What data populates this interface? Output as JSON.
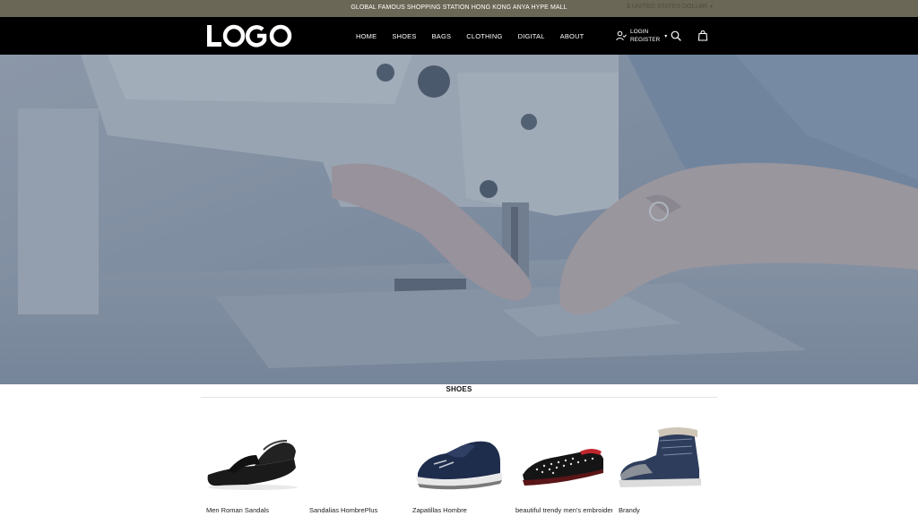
{
  "announcement": {
    "text": "GLOBAL FAMOUS SHOPPING STATION HONG KONG ANYA HYPE MALL",
    "currency": "$ UNITED STATES DOLLAR"
  },
  "header": {
    "logo_text": "LOGO",
    "nav": [
      "HOME",
      "SHOES",
      "BAGS",
      "CLOTHING",
      "DIGITAL",
      "ABOUT"
    ],
    "account": {
      "login": "LOGIN",
      "register": "REGISTER"
    },
    "icons": {
      "account": "user-check-icon",
      "search": "search-icon",
      "bag": "shopping-bag-icon"
    }
  },
  "hero": {
    "image": "sewing-machine-hands-photo"
  },
  "shoes_section": {
    "title": "SHOES",
    "products": [
      {
        "name": "Men Roman Sandals"
      },
      {
        "name": "Sandalias HombrePlus"
      },
      {
        "name": "Zapatillas Hombre"
      },
      {
        "name": "beautiful trendy men's embroidered loafers"
      },
      {
        "name": "Brandy"
      }
    ]
  },
  "colors": {
    "announcement_bg": "#6b6756",
    "header_bg": "#000000",
    "hero_overlay": "#4f6480"
  }
}
